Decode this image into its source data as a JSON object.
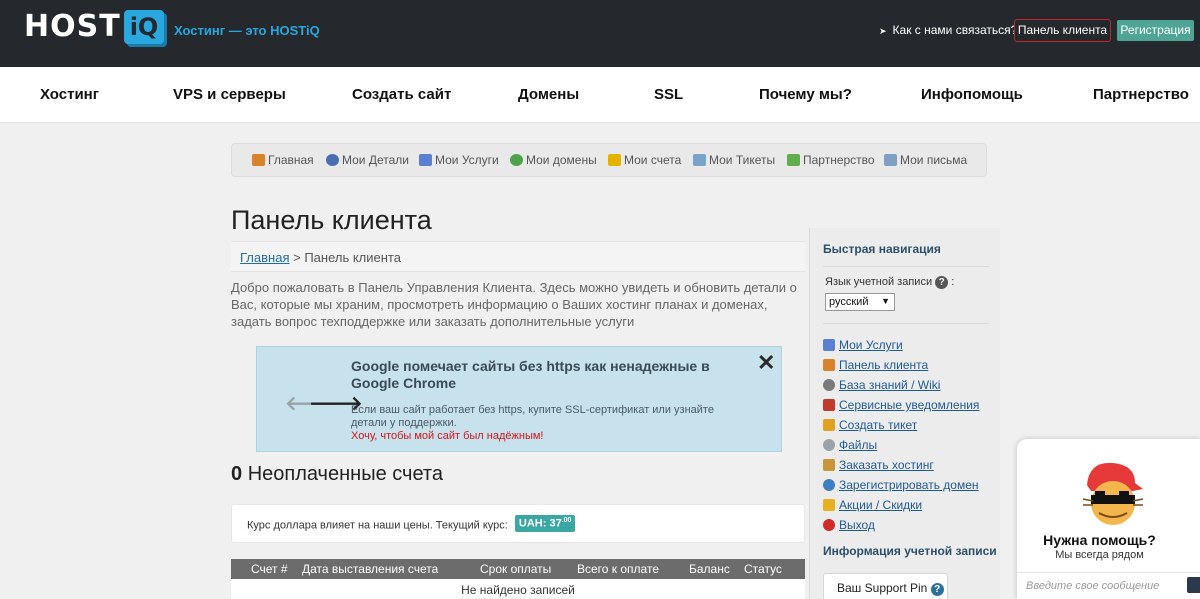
{
  "header": {
    "logo_text": "HOST",
    "logo_badge": "iQ",
    "tagline": "Хостинг — это HOSTiQ",
    "contact_link": "Как с нами связаться?",
    "client_panel_button": "Панель клиента",
    "register_button": "Регистрация"
  },
  "main_nav": [
    "Хостинг",
    "VPS и серверы",
    "Создать сайт",
    "Домены",
    "SSL",
    "Почему мы?",
    "Инфопомощь",
    "Партнерство"
  ],
  "sub_nav": [
    {
      "label": "Главная",
      "icon": "home-icon",
      "color": "#d9822b"
    },
    {
      "label": "Мои Детали",
      "icon": "user-icon",
      "color": "#4a6fb0"
    },
    {
      "label": "Мои Услуги",
      "icon": "chart-icon",
      "color": "#5b7fd1"
    },
    {
      "label": "Мои домены",
      "icon": "globe-icon",
      "color": "#4fa24b"
    },
    {
      "label": "Мои счета",
      "icon": "coins-icon",
      "color": "#e0b400"
    },
    {
      "label": "Мои Тикеты",
      "icon": "ticket-icon",
      "color": "#7aa3c9"
    },
    {
      "label": "Партнерство",
      "icon": "money-icon",
      "color": "#5fae4e"
    },
    {
      "label": "Мои письма",
      "icon": "mail-icon",
      "color": "#7f9fc4"
    }
  ],
  "page": {
    "title": "Панель клиента",
    "breadcrumb_home": "Главная",
    "breadcrumb_separator": " > ",
    "breadcrumb_current": "Панель клиента",
    "intro": "Добро пожаловать в Панель Управления Клиента. Здесь можно увидеть и обновить детали о Вас, которые мы храним, просмотреть информацию о Ваших хостинг планах и доменах, задать вопрос техподдержке или заказать дополнительные услуги"
  },
  "alert": {
    "title": "Google помечает сайты без https как ненадежные в Google Chrome",
    "text": "Если ваш сайт работает без https, купите SSL-сертификат или узнайте детали у поддержки.",
    "link": "Хочу, чтобы мой сайт был надёжным!",
    "prev_arrow": "🡐",
    "next_arrow": "🡒",
    "close": "✕"
  },
  "invoices": {
    "count": "0",
    "label": "Неоплаченные счета",
    "rate_text": "Курс доллара влияет на наши цены. Текущий курс:",
    "rate_badge": "UAH: 37",
    "rate_badge_decimals": ".00",
    "columns": [
      "Счет #",
      "Дата выставления счета",
      "Срок оплаты",
      "Всего к оплате",
      "Баланс",
      "Статус"
    ],
    "empty_message": "Не найдено записей"
  },
  "sidebar": {
    "quick_nav_title": "Быстрая навигация",
    "language_label": "Язык учетной записи",
    "language_help": "?",
    "language_colon": ":",
    "language_value": "русский",
    "items": [
      {
        "label": "Мои Услуги",
        "icon": "chart-icon",
        "color": "#5b7fd1"
      },
      {
        "label": "Панель клиента",
        "icon": "home-icon",
        "color": "#d9822b"
      },
      {
        "label": "База знаний / Wiki",
        "icon": "search-icon",
        "color": "#7a7a7a"
      },
      {
        "label": "Сервисные уведомления",
        "icon": "broadcast-icon",
        "color": "#c0392b"
      },
      {
        "label": "Создать тикет",
        "icon": "edit-icon",
        "color": "#e0a020"
      },
      {
        "label": "Файлы",
        "icon": "disc-icon",
        "color": "#9aa3a8"
      },
      {
        "label": "Заказать хостинг",
        "icon": "box-icon",
        "color": "#c9953b"
      },
      {
        "label": "Зарегистрировать домен",
        "icon": "globe-icon",
        "color": "#3f7fc1"
      },
      {
        "label": "Акции / Скидки",
        "icon": "gift-icon",
        "color": "#e7b020"
      },
      {
        "label": "Выход",
        "icon": "logout-icon",
        "color": "#d12b2b"
      }
    ],
    "account_info_title": "Информация учетной записи",
    "support_pin_label": "Ваш Support Pin",
    "support_pin_help": "?"
  },
  "chat": {
    "title": "Нужна помощь?",
    "subtitle": "Мы всегда рядом",
    "input_placeholder": "Введите свое сообщение"
  }
}
